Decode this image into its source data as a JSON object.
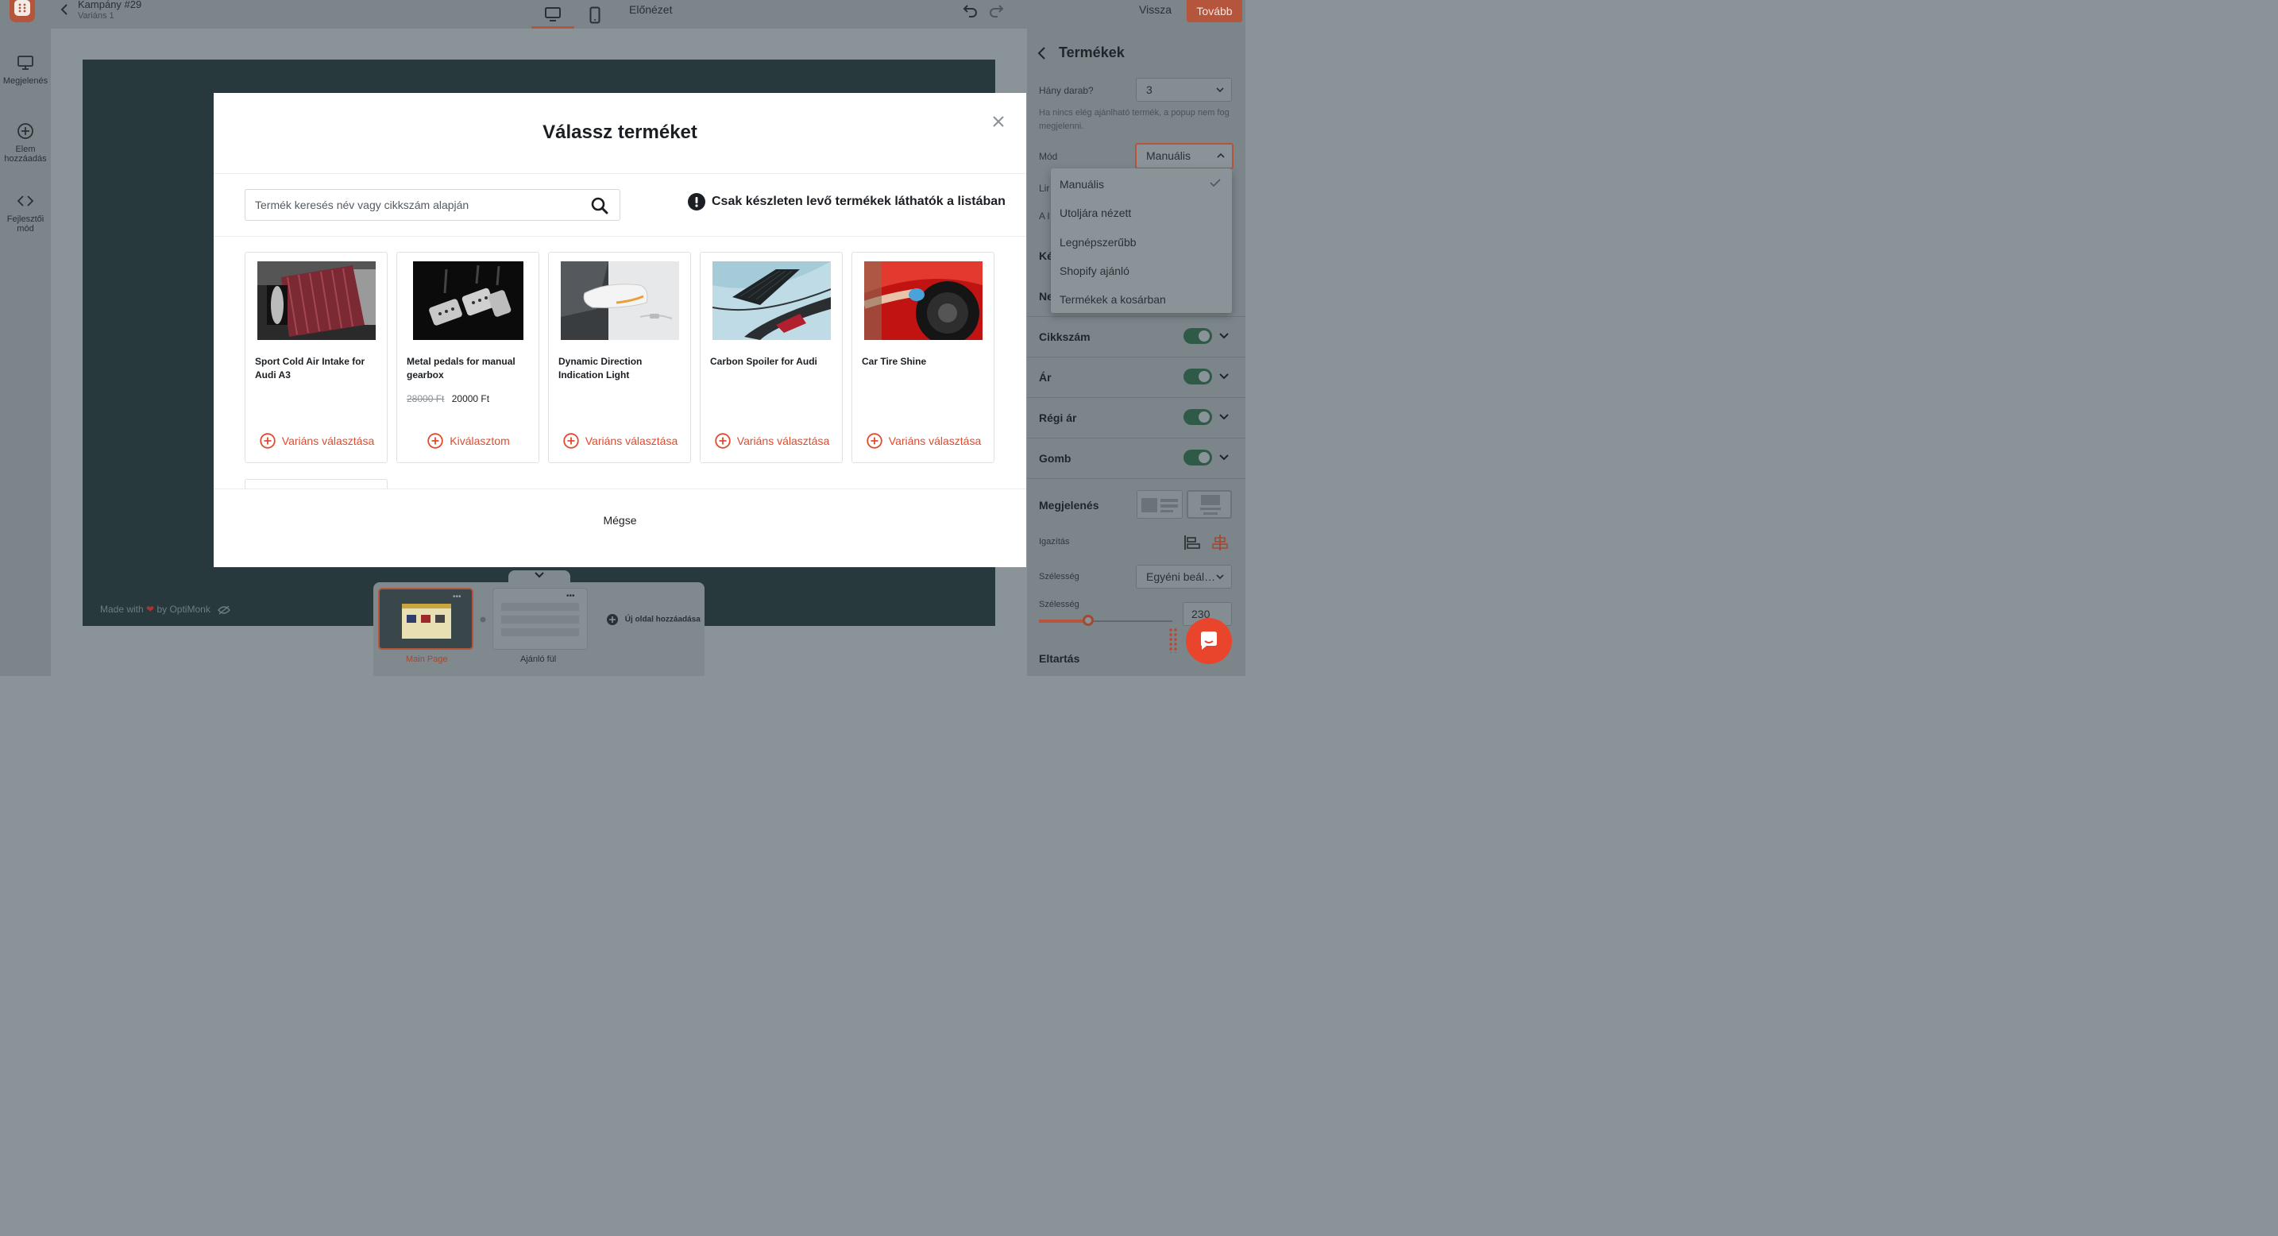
{
  "header": {
    "title": "Kampány #29",
    "subtitle": "Variáns 1",
    "preview_label": "Előnézet",
    "back_label": "Vissza",
    "next_label": "Tovább"
  },
  "left_sidebar": {
    "items": [
      {
        "label": "Megjelenés",
        "icon": "monitor-icon"
      },
      {
        "label": "Elem hozzáadás",
        "icon": "plus-circle-icon"
      },
      {
        "label": "Fejlesztői mód",
        "icon": "code-icon"
      }
    ]
  },
  "canvas": {
    "made_with": "Made with",
    "by": "by OptiMonk"
  },
  "right_panel": {
    "title": "Termékek",
    "count_label": "Hány darab?",
    "count_value": "3",
    "help_text": "Ha nincs elég ajánlható termék, a popup nem fog megjelenni.",
    "mode_label": "Mód",
    "mode_value": "Manuális",
    "hidden_label_1": "Lir",
    "hidden_label_2": "A l",
    "hidden_label_3": "Ké",
    "hidden_label_4": "Ne",
    "toggles": [
      {
        "label": "Cikkszám",
        "on": true
      },
      {
        "label": "Ár",
        "on": true
      },
      {
        "label": "Régi ár",
        "on": true
      },
      {
        "label": "Gomb",
        "on": true
      }
    ],
    "appearance_label": "Megjelenés",
    "align_label": "Igazítás",
    "width_label": "Szélesség",
    "width_mode": "Egyéni beál…",
    "width_label_2": "Szélesség",
    "width_value": "230 px",
    "width_slider_fraction": 0.37,
    "spacing_label": "Eltartás"
  },
  "mode_dropdown": {
    "options": [
      "Manuális",
      "Utoljára nézett",
      "Legnépszerűbb",
      "Shopify ajánló",
      "Termékek a kosárban"
    ],
    "selected": "Manuális"
  },
  "page_bar": {
    "pages": [
      {
        "label": "Main Page",
        "active": true
      },
      {
        "label": "Ajánló fül",
        "active": false
      }
    ],
    "add_label": "Új oldal hozzáadása"
  },
  "modal": {
    "title": "Válassz terméket",
    "search_placeholder": "Termék keresés név vagy cikkszám alapján",
    "notice": "Csak készleten levő termékek láthatók a listában",
    "products": [
      {
        "name": "Sport Cold Air Intake for Audi A3",
        "action": "Variáns választása",
        "old_price": "",
        "price": ""
      },
      {
        "name": "Metal pedals for manual gearbox",
        "action": "Kiválasztom",
        "old_price": "28000 Ft",
        "price": "20000 Ft"
      },
      {
        "name": "Dynamic Direction Indication Light",
        "action": "Variáns választása",
        "old_price": "",
        "price": ""
      },
      {
        "name": "Carbon Spoiler for Audi",
        "action": "Variáns választása",
        "old_price": "",
        "price": ""
      },
      {
        "name": "Car Tire Shine",
        "action": "Variáns választása",
        "old_price": "",
        "price": ""
      }
    ],
    "cancel_label": "Mégse"
  },
  "colors": {
    "accent": "#e14a2c",
    "toggle_on": "#2f5a47"
  }
}
